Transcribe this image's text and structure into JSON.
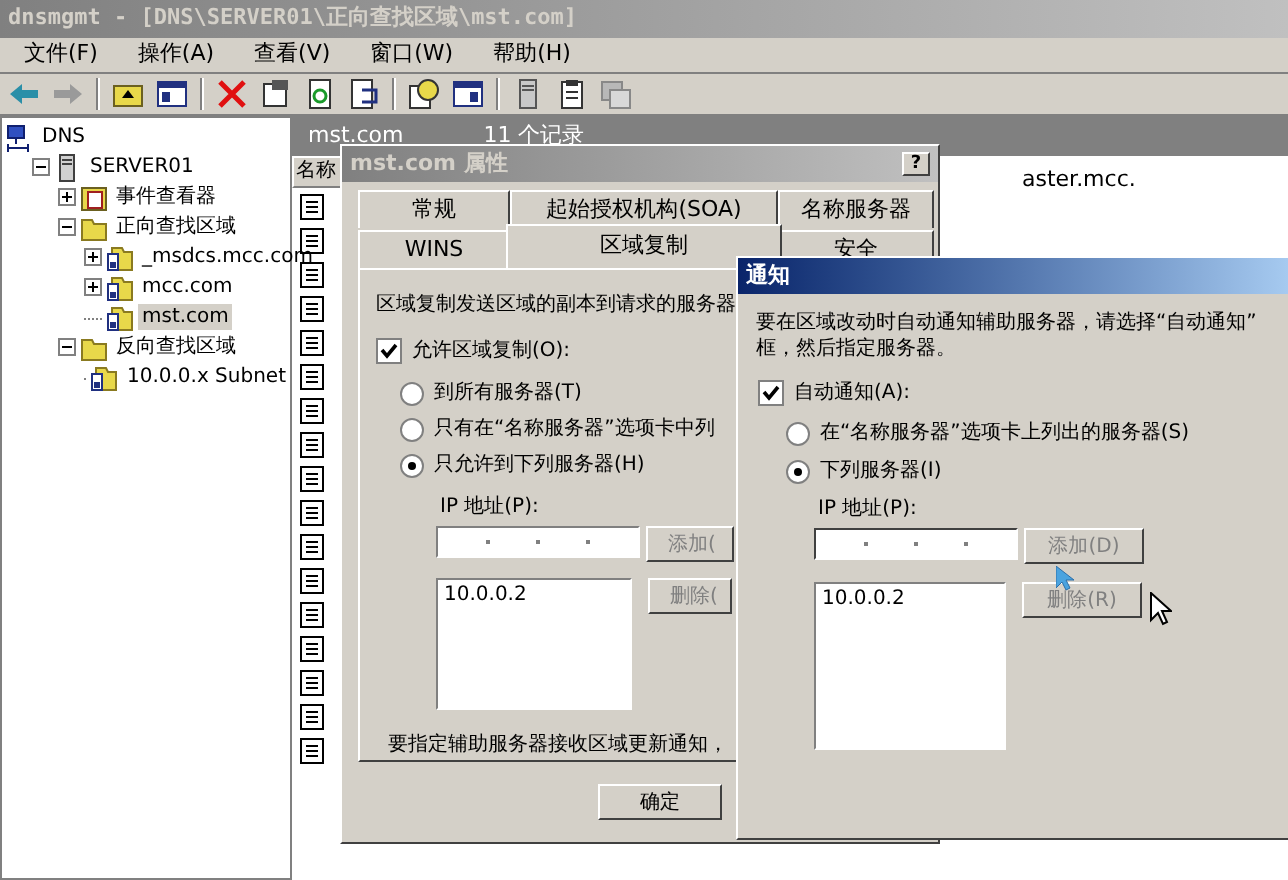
{
  "window": {
    "title": "dnsmgmt - [DNS\\SERVER01\\正向查找区域\\mst.com]"
  },
  "menu": [
    "文件(F)",
    "操作(A)",
    "查看(V)",
    "窗口(W)",
    "帮助(H)"
  ],
  "tree": [
    {
      "label": "DNS",
      "kind": "dns",
      "selected": false,
      "children": [
        {
          "label": "SERVER01",
          "kind": "server",
          "expanded": true,
          "selected": false,
          "children": [
            {
              "label": "事件查看器",
              "kind": "log",
              "expanded": false,
              "selected": false
            },
            {
              "label": "正向查找区域",
              "kind": "folder",
              "expanded": true,
              "selected": false,
              "children": [
                {
                  "label": "_msdcs.mcc.com",
                  "kind": "zone",
                  "expanded": false,
                  "selected": false
                },
                {
                  "label": "mcc.com",
                  "kind": "zone",
                  "expanded": false,
                  "selected": false
                },
                {
                  "label": "mst.com",
                  "kind": "zone",
                  "selected": true
                }
              ]
            },
            {
              "label": "反向查找区域",
              "kind": "folder",
              "expanded": true,
              "selected": false,
              "children": [
                {
                  "label": "10.0.0.x Subnet",
                  "kind": "zone",
                  "selected": false
                }
              ]
            }
          ]
        }
      ]
    }
  ],
  "records_pane": {
    "title": "mst.com",
    "count": "11 个记录",
    "column": "名称",
    "cell": "aster.mcc."
  },
  "properties_dialog": {
    "title": "mst.com 属性",
    "help_button": "?",
    "tabs": [
      {
        "label": "常规",
        "selected": false
      },
      {
        "label": "起始授权机构(SOA)",
        "selected": false
      },
      {
        "label": "名称服务器",
        "selected": false
      },
      {
        "label": "WINS",
        "selected": false
      },
      {
        "label": "区域复制",
        "selected": true
      },
      {
        "label": "安全",
        "selected": false
      }
    ],
    "description": "区域复制发送区域的副本到请求的服务器",
    "allow_transfer": {
      "label": "允许区域复制(O):",
      "checked": true
    },
    "options": [
      {
        "label": "到所有服务器(T)",
        "selected": false
      },
      {
        "label": "只有在“名称服务器”选项卡中列",
        "selected": false
      },
      {
        "label": "只允许到下列服务器(H)",
        "selected": true
      }
    ],
    "ip_label": "IP 地址(P):",
    "add_button": {
      "label": "添加(",
      "disabled": true
    },
    "servers": [
      "10.0.0.2"
    ],
    "remove_button": {
      "label": "删除(",
      "disabled": true
    },
    "notify_text": "要指定辅助服务器接收区域更新通知，",
    "ok_button": "确定"
  },
  "notify_dialog": {
    "title": "通知",
    "description_lines": [
      "要在区域改动时自动通知辅助服务器，请选择“自动通知”",
      "框，然后指定服务器。"
    ],
    "auto_notify": {
      "label": "自动通知(A):",
      "checked": true
    },
    "options": [
      {
        "label": "在“名称服务器”选项卡上列出的服务器(S)",
        "selected": false
      },
      {
        "label": "下列服务器(I)",
        "selected": true
      }
    ],
    "ip_label": "IP 地址(P):",
    "add_button": {
      "label": "添加(D)",
      "disabled": true
    },
    "servers": [
      "10.0.0.2"
    ],
    "remove_button": {
      "label": "删除(R)",
      "disabled": true
    }
  }
}
